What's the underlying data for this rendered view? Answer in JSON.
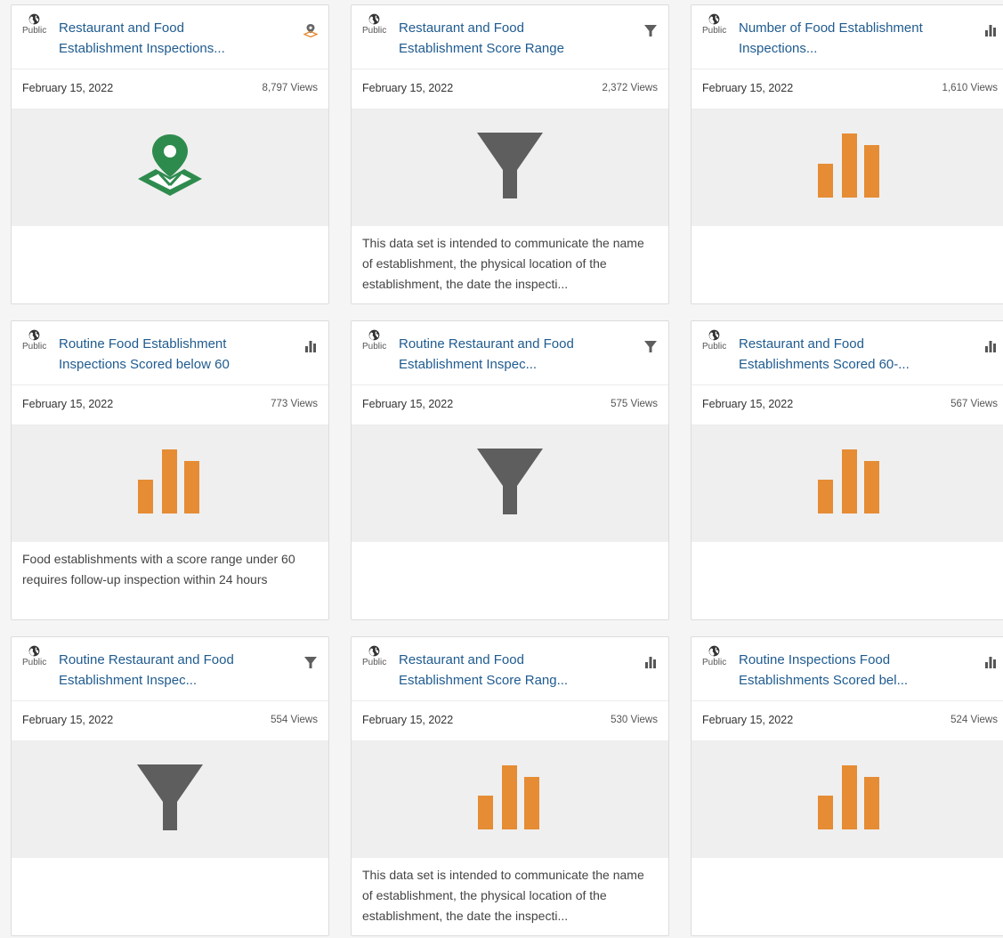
{
  "colors": {
    "link": "#1f5b8f",
    "bar": "#e58c34",
    "funnel": "#5e5e5e",
    "map": "#2e8b4e",
    "preview_bg": "#efefef"
  },
  "cards": [
    {
      "visibility": "Public",
      "title": "Restaurant and Food Establishment Inspections...",
      "type_icon": "map-icon",
      "date": "February 15, 2022",
      "views": "8,797 Views",
      "description": ""
    },
    {
      "visibility": "Public",
      "title": "Restaurant and Food Establishment Score Range",
      "type_icon": "filter-icon",
      "date": "February 15, 2022",
      "views": "2,372 Views",
      "description": "This data set is intended to communicate the name of establishment, the physical location of the establishment, the date the inspecti..."
    },
    {
      "visibility": "Public",
      "title": "Number of Food Establishment Inspections...",
      "type_icon": "bar-chart-icon",
      "date": "February 15, 2022",
      "views": "1,610 Views",
      "description": ""
    },
    {
      "visibility": "Public",
      "title": "Routine Food Establishment Inspections Scored below 60",
      "type_icon": "bar-chart-icon",
      "date": "February 15, 2022",
      "views": "773 Views",
      "description": "Food establishments with a score range under 60 requires follow-up inspection within 24 hours"
    },
    {
      "visibility": "Public",
      "title": "Routine Restaurant and Food Establishment Inspec...",
      "type_icon": "filter-icon",
      "date": "February 15, 2022",
      "views": "575 Views",
      "description": ""
    },
    {
      "visibility": "Public",
      "title": "Restaurant and Food Establishments Scored 60-...",
      "type_icon": "bar-chart-icon",
      "date": "February 15, 2022",
      "views": "567 Views",
      "description": ""
    },
    {
      "visibility": "Public",
      "title": "Routine Restaurant and Food Establishment Inspec...",
      "type_icon": "filter-icon",
      "date": "February 15, 2022",
      "views": "554 Views",
      "description": ""
    },
    {
      "visibility": "Public",
      "title": "Restaurant and Food Establishment Score Rang...",
      "type_icon": "bar-chart-icon",
      "date": "February 15, 2022",
      "views": "530 Views",
      "description": "This data set is intended to communicate the name of establishment, the physical location of the establishment, the date the inspecti..."
    },
    {
      "visibility": "Public",
      "title": "Routine Inspections Food Establishments Scored bel...",
      "type_icon": "bar-chart-icon",
      "date": "February 15, 2022",
      "views": "524 Views",
      "description": ""
    }
  ]
}
